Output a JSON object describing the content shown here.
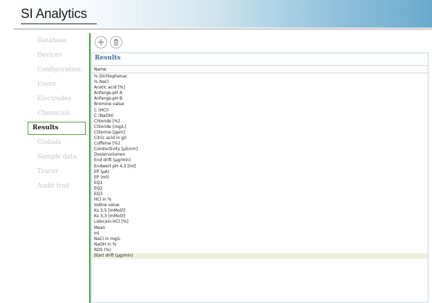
{
  "app": {
    "logo_text": "SI Analytics",
    "accent_color": "#3d9a33",
    "title_color": "#3e6f9a"
  },
  "toolbar": {
    "add_icon": "plus-circle-icon",
    "delete_icon": "trash-icon"
  },
  "sidebar": {
    "items": [
      {
        "label": "Database",
        "active": false
      },
      {
        "label": "Devices",
        "active": false
      },
      {
        "label": "Configuration",
        "active": false
      },
      {
        "label": "Users",
        "active": false
      },
      {
        "label": "Electrodes",
        "active": false
      },
      {
        "label": "Chemicals",
        "active": false
      },
      {
        "label": "Results",
        "active": true
      },
      {
        "label": "Globals",
        "active": false
      },
      {
        "label": "Sample data",
        "active": false
      },
      {
        "label": "Tracer",
        "active": false
      },
      {
        "label": "Audit trail",
        "active": false
      }
    ]
  },
  "results": {
    "title": "Results",
    "column_header": "Name",
    "selected_index": 32,
    "rows": [
      "% Dichlophenac",
      "% NaCl",
      "Acetic acid [%]",
      "Anfangs-pH A",
      "Anfangs-pH B",
      "Bromine value",
      "C (HCl)",
      "C (NaOH)",
      "Chloride [%]",
      "Chloride [mg/L]",
      "Chlorine [ppm]",
      "Citric acid in g/l",
      "Coffeine [%]",
      "Conductivity [µS/cm]",
      "Dosiervolumen",
      "End drift (µg/min)",
      "Endwert pH 4,3 [ml]",
      "EP (µA)",
      "EP (ml)",
      "EQ1",
      "EQ2",
      "EQ3",
      "HCl in %",
      "Iodine value",
      "Ks 3,5 [mMol/l]",
      "Ks 3,3 [mMol/l]",
      "Lidocain-HCl [%]",
      "Mean",
      "ml",
      "NaCl in mg/L",
      "NaOH in %",
      "RDS (%)",
      "Start drift (µg/min)"
    ]
  }
}
